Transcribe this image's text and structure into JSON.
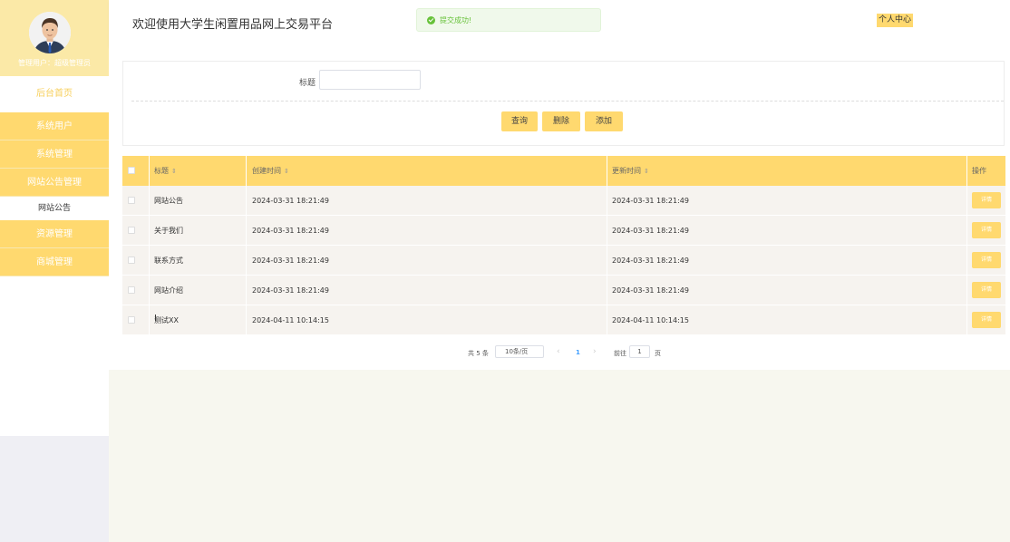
{
  "sidebar": {
    "user_role": "管理用户：",
    "user_name": "超级管理员",
    "home": "后台首页",
    "menu": [
      {
        "label": "系统用户"
      },
      {
        "label": "系统管理"
      },
      {
        "label": "网站公告管理"
      }
    ],
    "submenu": "网站公告",
    "menu_after": [
      {
        "label": "资源管理"
      },
      {
        "label": "商城管理"
      }
    ]
  },
  "header": {
    "title": "欢迎使用大学生闲置用品网上交易平台",
    "toast": "提交成功!",
    "profile": "个人中心"
  },
  "search": {
    "label": "标题",
    "value": "",
    "query": "查询",
    "delete": "删除",
    "add": "添加"
  },
  "table": {
    "headers": {
      "title": "标题",
      "created": "创建时间",
      "updated": "更新时间",
      "actions": "操作"
    },
    "detail_label": "详情",
    "rows": [
      {
        "title": "网站公告",
        "created": "2024-03-31 18:21:49",
        "updated": "2024-03-31 18:21:49"
      },
      {
        "title": "关于我们",
        "created": "2024-03-31 18:21:49",
        "updated": "2024-03-31 18:21:49"
      },
      {
        "title": "联系方式",
        "created": "2024-03-31 18:21:49",
        "updated": "2024-03-31 18:21:49"
      },
      {
        "title": "网站介绍",
        "created": "2024-03-31 18:21:49",
        "updated": "2024-03-31 18:21:49"
      },
      {
        "title": "测试XX",
        "created": "2024-04-11 10:14:15",
        "updated": "2024-04-11 10:14:15"
      }
    ]
  },
  "pagination": {
    "total": "共 5 条",
    "page_size": "10条/页",
    "current": "1",
    "goto": "前往",
    "goto_value": "1",
    "page_unit": "页"
  },
  "colors": {
    "accent": "#ffd96f",
    "sidebar_top": "#fbe9a7",
    "success": "#67c23a"
  }
}
